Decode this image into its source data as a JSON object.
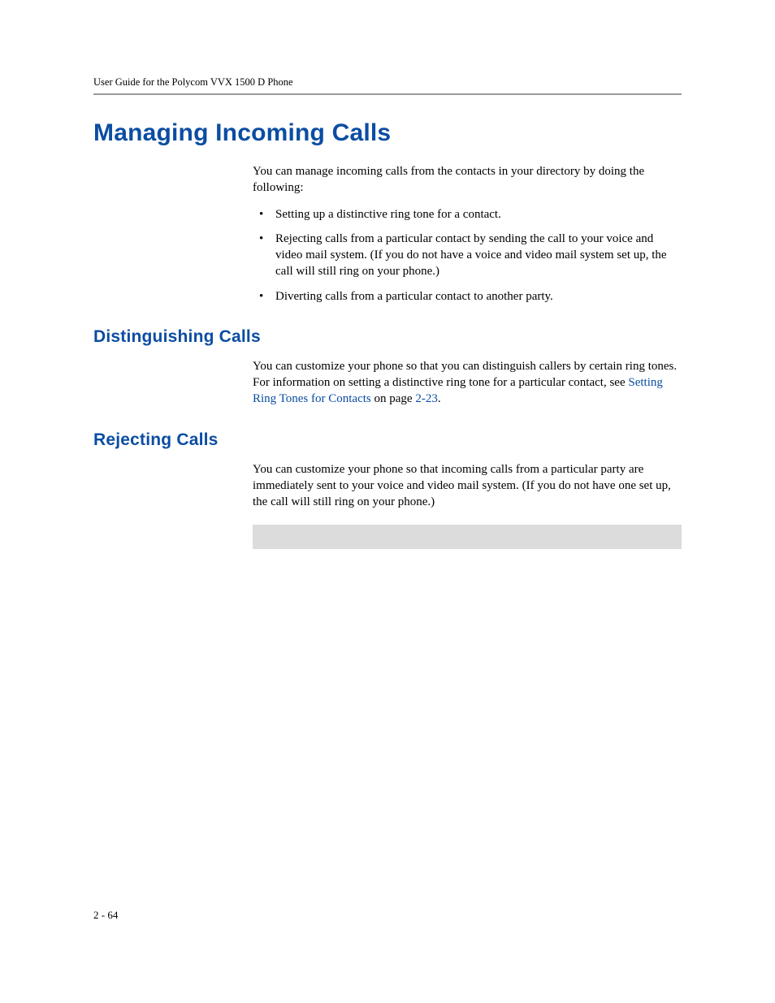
{
  "header": {
    "running_title": "User Guide for the Polycom VVX 1500 D Phone"
  },
  "title": "Managing Incoming Calls",
  "intro": "You can manage incoming calls from the contacts in your directory by doing the following:",
  "bullets": [
    "Setting up a distinctive ring tone for a contact.",
    "Rejecting calls from a particular contact by sending the call to your voice and video mail system. (If you do not have a voice and video mail system set up, the call will still ring on your phone.)",
    "Diverting calls from a particular contact to another party."
  ],
  "sections": {
    "distinguishing": {
      "heading": "Distinguishing Calls",
      "para_prefix": "You can customize your phone so that you can distinguish callers by certain ring tones. For information on setting a distinctive ring tone for a particular contact, see ",
      "link_text": "Setting Ring Tones for Contacts",
      "para_mid": " on page ",
      "page_ref": "2-23",
      "para_suffix": "."
    },
    "rejecting": {
      "heading": "Rejecting Calls",
      "para": "You can customize your phone so that incoming calls from a particular party are immediately sent to your voice and video mail system. (If you do not have one set up, the call will still ring on your phone.)"
    }
  },
  "footer": {
    "page_number": "2 - 64"
  }
}
